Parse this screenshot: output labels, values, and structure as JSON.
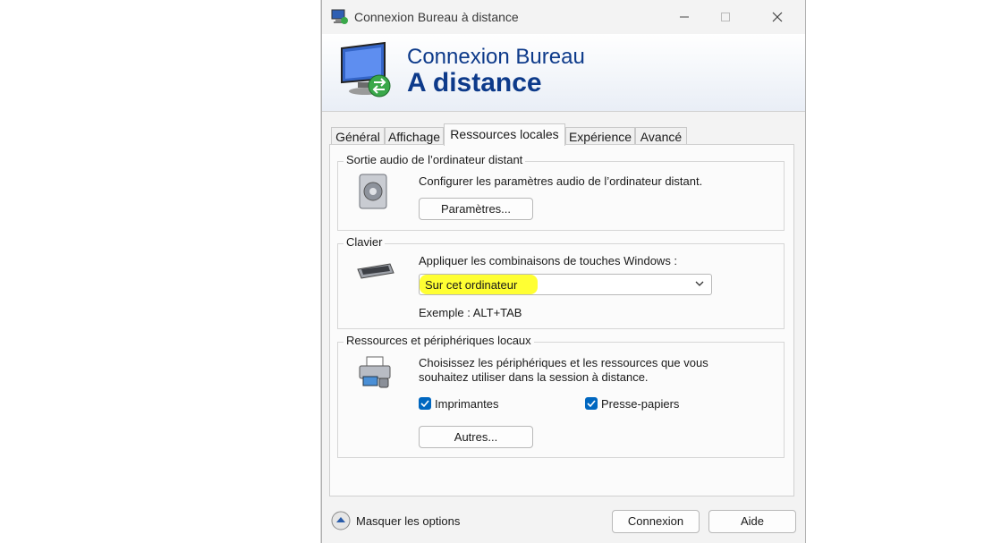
{
  "window": {
    "title": "Connexion Bureau à distance"
  },
  "banner": {
    "line1": "Connexion Bureau",
    "line2": "A distance"
  },
  "tabs": [
    {
      "label": "Général"
    },
    {
      "label": "Affichage"
    },
    {
      "label": "Ressources locales"
    },
    {
      "label": "Expérience"
    },
    {
      "label": "Avancé"
    }
  ],
  "audio": {
    "title": "Sortie audio de l’ordinateur distant",
    "description": "Configurer les paramètres audio de l’ordinateur distant.",
    "button": "Paramètres..."
  },
  "keyboard": {
    "title": "Clavier",
    "description": "Appliquer les combinaisons de touches Windows :",
    "selected": "Sur cet ordinateur",
    "example": "Exemple : ALT+TAB"
  },
  "devices": {
    "title": "Ressources et périphériques locaux",
    "description_line1": "Choisissez les périphériques et les ressources que vous",
    "description_line2": "souhaitez utiliser dans la session à distance.",
    "printers": {
      "label": "Imprimantes",
      "checked": true
    },
    "clipboard": {
      "label": "Presse-papiers",
      "checked": true
    },
    "button": "Autres..."
  },
  "footer": {
    "toggle_label": "Masquer les options",
    "connect": "Connexion",
    "help": "Aide"
  },
  "colors": {
    "accent": "#0067c0",
    "brand": "#0d3a8a",
    "highlight": "#ffff33"
  }
}
